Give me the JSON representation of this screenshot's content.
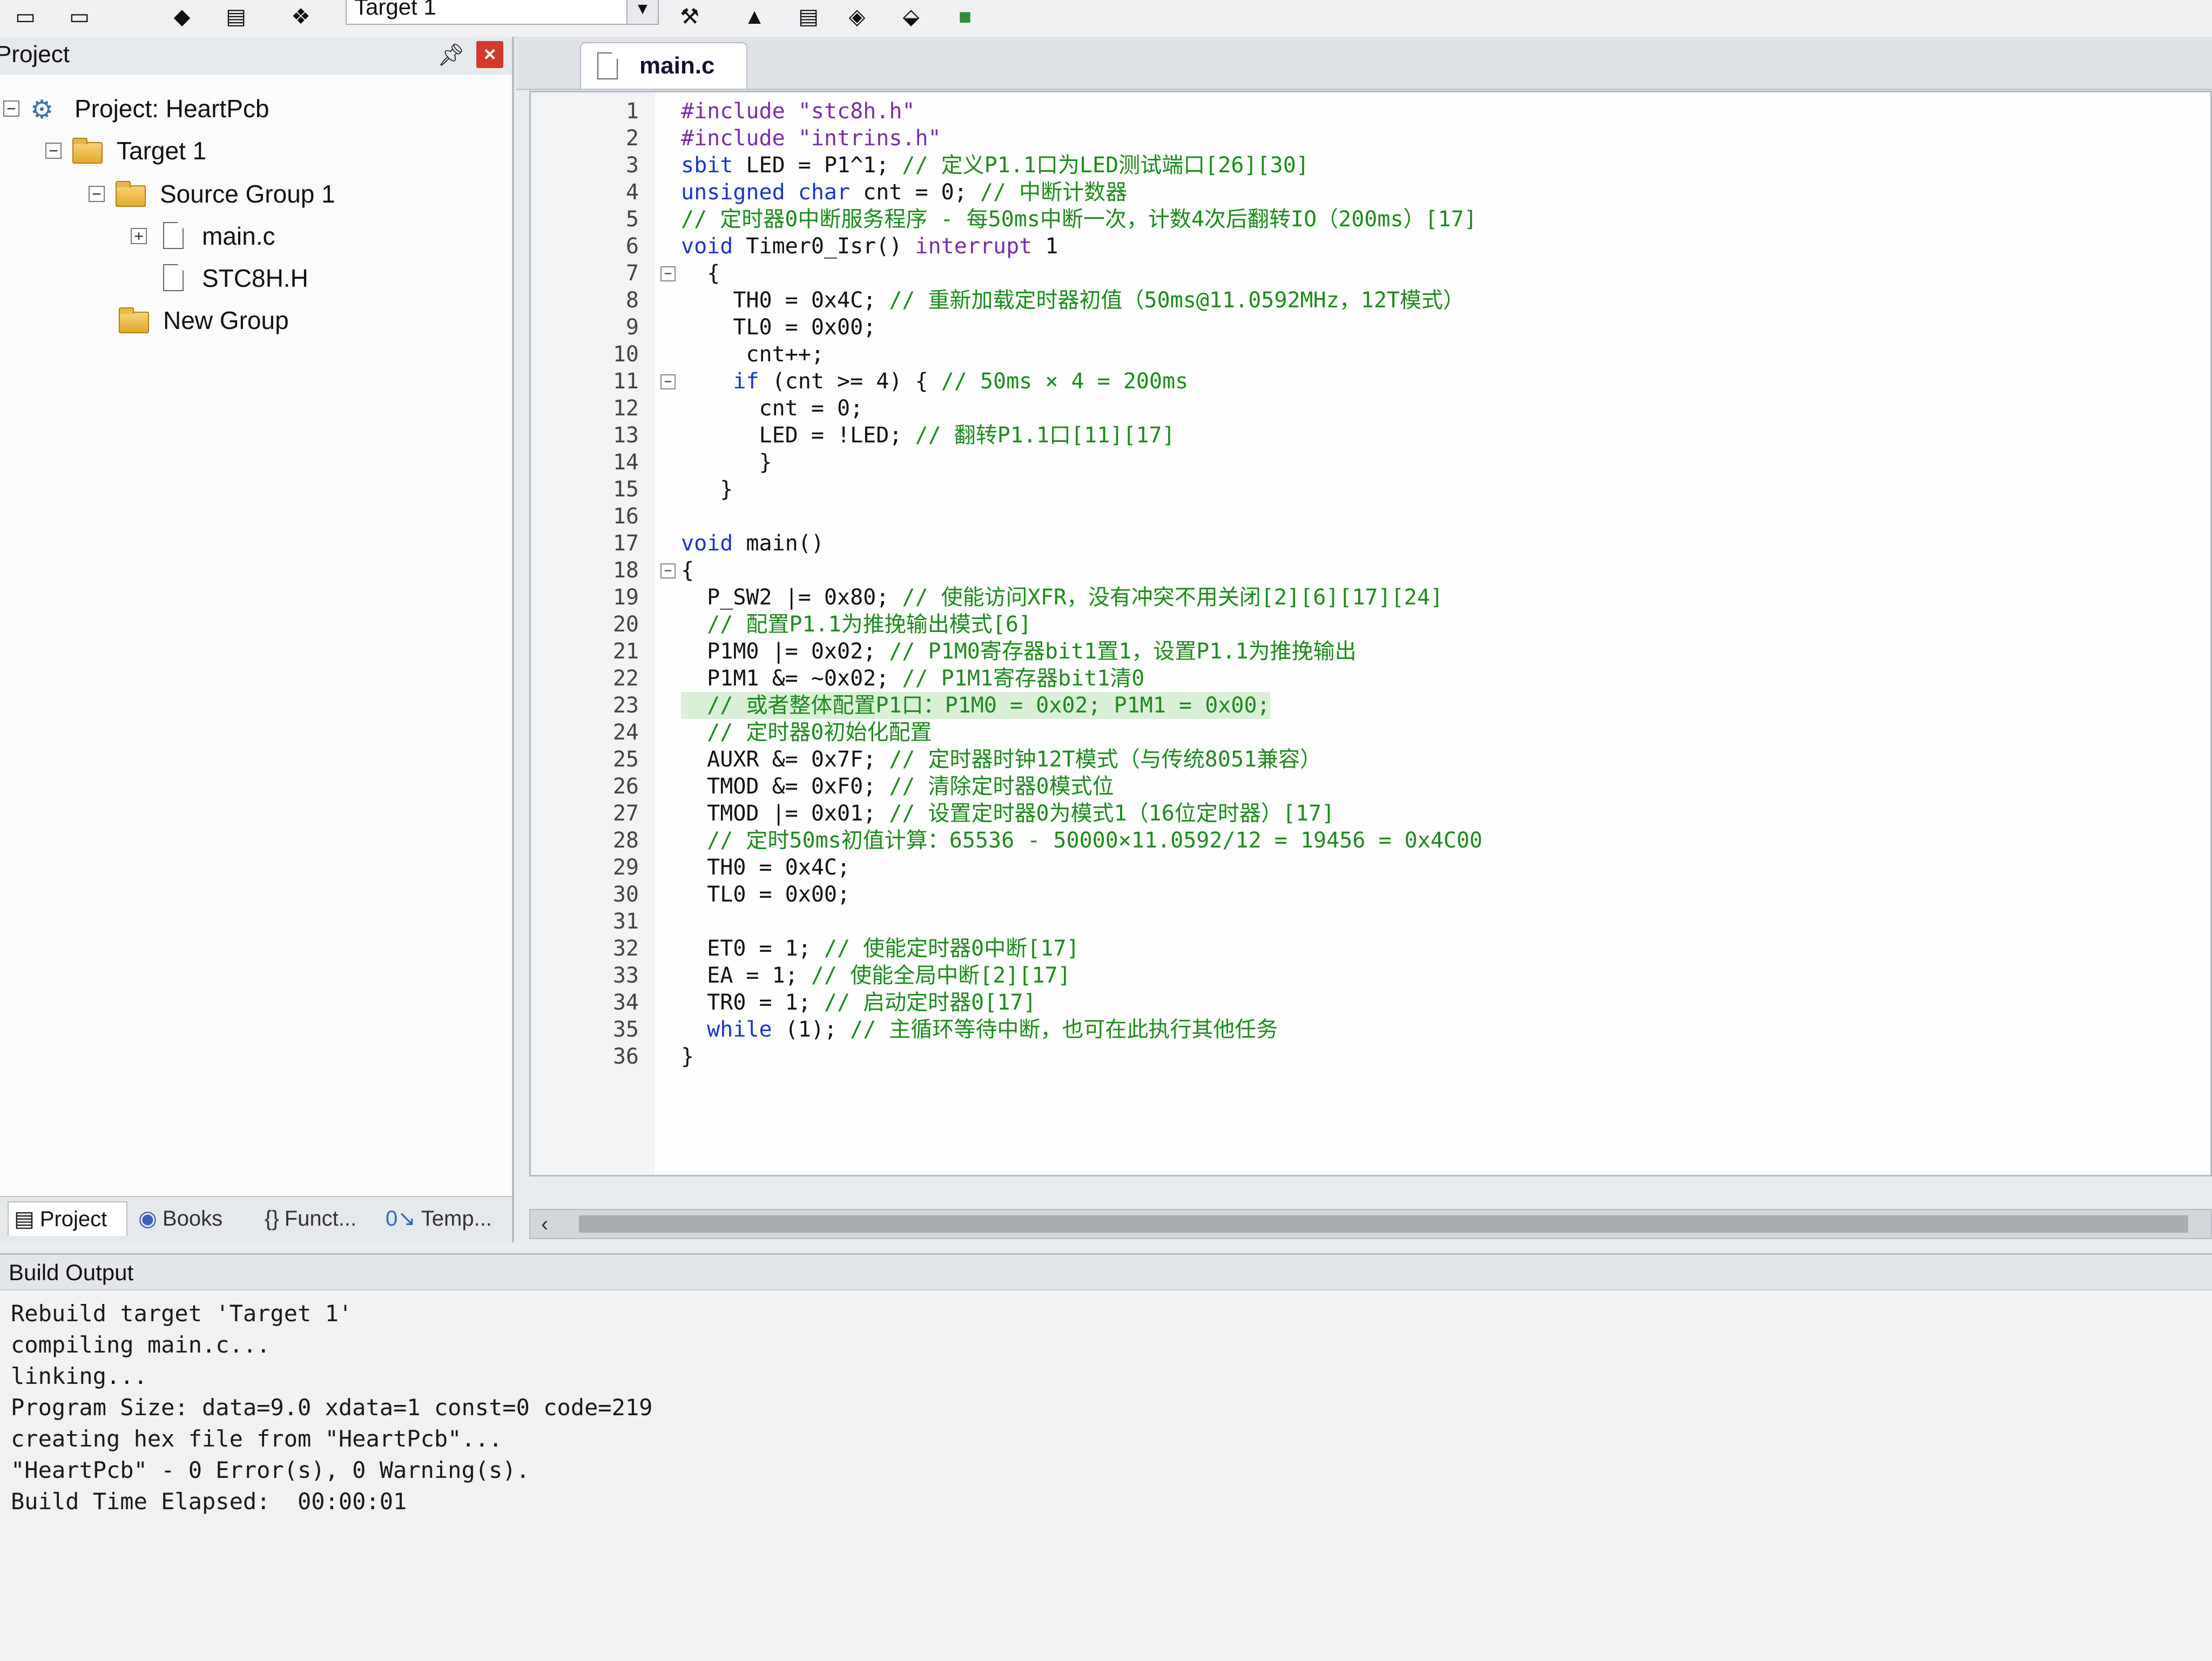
{
  "toolbar": {
    "target_label": "Target 1"
  },
  "project_panel": {
    "title": "Project",
    "tree": {
      "project": "Project: HeartPcb",
      "target": "Target 1",
      "group": "Source Group 1",
      "files": [
        "main.c",
        "STC8H.H"
      ],
      "new_group": "New Group"
    },
    "tabs": [
      "Project",
      "Books",
      "Funct...",
      "Temp..."
    ]
  },
  "editor": {
    "tab": "main.c",
    "highlight_line": 23,
    "lines": [
      {
        "n": "1",
        "t": [
          [
            "pp",
            "#include \"stc8h.h\""
          ]
        ]
      },
      {
        "n": "2",
        "t": [
          [
            "pp",
            "#include \"intrins.h\""
          ]
        ]
      },
      {
        "n": "3",
        "t": [
          [
            "kw",
            "sbit"
          ],
          [
            "",
            "LED = P1^1; "
          ],
          [
            "cm",
            "// 定义P1.1口为LED测试端口[26][30]"
          ]
        ]
      },
      {
        "n": "4",
        "t": [
          [
            "kw",
            "unsigned char"
          ],
          [
            "",
            "cnt = 0; "
          ],
          [
            "cm",
            "// 中断计数器"
          ]
        ]
      },
      {
        "n": "5",
        "t": [
          [
            "cm",
            "// 定时器0中断服务程序 - 每50ms中断一次，计数4次后翻转IO（200ms）[17]"
          ]
        ]
      },
      {
        "n": "6",
        "t": [
          [
            "kw",
            "void"
          ],
          [
            "",
            "Timer0_Isr() "
          ],
          [
            "str",
            "interrupt"
          ],
          [
            "",
            " 1"
          ]
        ]
      },
      {
        "n": "7",
        "f": "⊟",
        "t": [
          [
            "",
            "  {"
          ]
        ]
      },
      {
        "n": "8",
        "t": [
          [
            "",
            "    TH0 = 0x4C; "
          ],
          [
            "cm",
            "// 重新加载定时器初值（50ms@11.0592MHz，12T模式）"
          ]
        ]
      },
      {
        "n": "9",
        "t": [
          [
            "",
            "    TL0 = 0x00;"
          ]
        ]
      },
      {
        "n": "10",
        "t": [
          [
            "",
            "     cnt++;"
          ]
        ]
      },
      {
        "n": "11",
        "f": "⊟",
        "t": [
          [
            "",
            "    "
          ],
          [
            "kw",
            "if"
          ],
          [
            "",
            "(cnt >= 4) { "
          ],
          [
            "cm",
            "// 50ms × 4 = 200ms"
          ]
        ]
      },
      {
        "n": "12",
        "t": [
          [
            "",
            "      cnt = 0;"
          ]
        ]
      },
      {
        "n": "13",
        "t": [
          [
            "",
            "      LED = !LED; "
          ],
          [
            "cm",
            "// 翻转P1.1口[11][17]"
          ]
        ]
      },
      {
        "n": "14",
        "t": [
          [
            "",
            "      }"
          ]
        ]
      },
      {
        "n": "15",
        "t": [
          [
            "",
            "   }"
          ]
        ]
      },
      {
        "n": "16",
        "t": [
          [
            "",
            ""
          ]
        ]
      },
      {
        "n": "17",
        "t": [
          [
            "kw",
            "void"
          ],
          [
            "",
            "main()"
          ]
        ]
      },
      {
        "n": "18",
        "f": "⊟",
        "t": [
          [
            "",
            "{"
          ]
        ]
      },
      {
        "n": "19",
        "t": [
          [
            "",
            "  P_SW2 |= 0x80; "
          ],
          [
            "cm",
            "// 使能访问XFR，没有冲突不用关闭[2][6][17][24]"
          ]
        ]
      },
      {
        "n": "20",
        "t": [
          [
            "",
            "  "
          ],
          [
            "cm",
            "// 配置P1.1为推挽输出模式[6]"
          ]
        ]
      },
      {
        "n": "21",
        "t": [
          [
            "",
            "  P1M0 |= 0x02; "
          ],
          [
            "cm",
            "// P1M0寄存器bit1置1，设置P1.1为推挽输出"
          ]
        ]
      },
      {
        "n": "22",
        "t": [
          [
            "",
            "  P1M1 &= ~0x02; "
          ],
          [
            "cm",
            "// P1M1寄存器bit1清0"
          ]
        ]
      },
      {
        "n": "23",
        "t": [
          [
            "",
            "  "
          ],
          [
            "cm",
            "// 或者整体配置P1口：P1M0 = 0x02; P1M1 = 0x00;"
          ]
        ]
      },
      {
        "n": "24",
        "t": [
          [
            "",
            "  "
          ],
          [
            "cm",
            "// 定时器0初始化配置"
          ]
        ]
      },
      {
        "n": "25",
        "t": [
          [
            "",
            "  AUXR &= 0x7F; "
          ],
          [
            "cm",
            "// 定时器时钟12T模式（与传统8051兼容）"
          ]
        ]
      },
      {
        "n": "26",
        "t": [
          [
            "",
            "  TMOD &= 0xF0; "
          ],
          [
            "cm",
            "// 清除定时器0模式位"
          ]
        ]
      },
      {
        "n": "27",
        "t": [
          [
            "",
            "  TMOD |= 0x01; "
          ],
          [
            "cm",
            "// 设置定时器0为模式1（16位定时器）[17]"
          ]
        ]
      },
      {
        "n": "28",
        "t": [
          [
            "",
            "  "
          ],
          [
            "cm",
            "// 定时50ms初值计算：65536 - 50000×11.0592/12 = 19456 = 0x4C00"
          ]
        ]
      },
      {
        "n": "29",
        "t": [
          [
            "",
            "  TH0 = 0x4C;"
          ]
        ]
      },
      {
        "n": "30",
        "t": [
          [
            "",
            "  TL0 = 0x00;"
          ]
        ]
      },
      {
        "n": "31",
        "t": [
          [
            "",
            ""
          ]
        ]
      },
      {
        "n": "32",
        "t": [
          [
            "",
            "  ET0 = 1; "
          ],
          [
            "cm",
            "// 使能定时器0中断[17]"
          ]
        ]
      },
      {
        "n": "33",
        "t": [
          [
            "",
            "  EA = 1; "
          ],
          [
            "cm",
            "// 使能全局中断[2][17]"
          ]
        ]
      },
      {
        "n": "34",
        "t": [
          [
            "",
            "  TR0 = 1; "
          ],
          [
            "cm",
            "// 启动定时器0[17]"
          ]
        ]
      },
      {
        "n": "35",
        "t": [
          [
            "",
            "  "
          ],
          [
            "kw",
            "while"
          ],
          [
            "",
            "(1); "
          ],
          [
            "cm",
            "// 主循环等待中断，也可在此执行其他任务"
          ]
        ]
      },
      {
        "n": "36",
        "t": [
          [
            "",
            "}"
          ]
        ]
      }
    ]
  },
  "build_output": {
    "title": "Build Output",
    "lines": [
      "Rebuild target 'Target 1'",
      "compiling main.c...",
      "linking...",
      "Program Size: data=9.0 xdata=1 const=0 code=219",
      "creating hex file from \"HeartPcb\"...",
      "\"HeartPcb\" - 0 Error(s), 0 Warning(s).",
      "Build Time Elapsed:  00:00:01"
    ]
  }
}
